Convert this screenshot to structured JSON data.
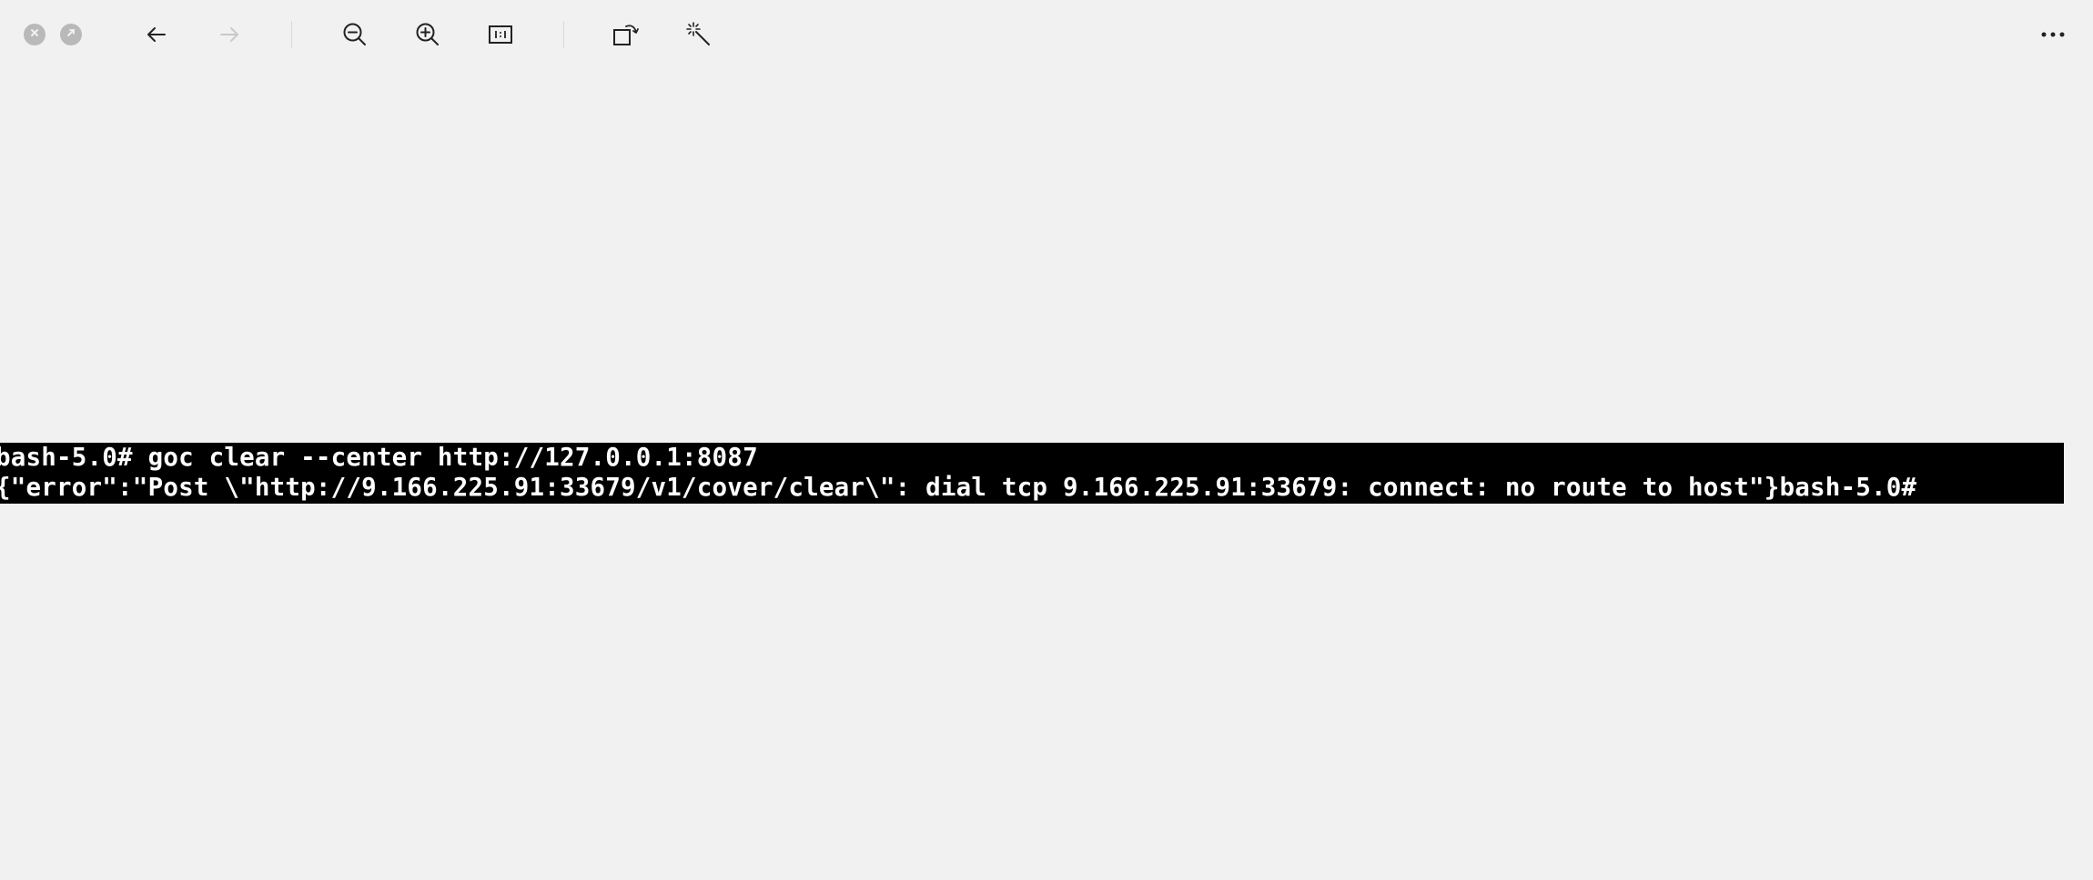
{
  "window": {
    "controls": [
      {
        "name": "close-button",
        "icon": "close-icon"
      },
      {
        "name": "restore-button",
        "icon": "restore-icon"
      }
    ]
  },
  "toolbar": {
    "items": [
      {
        "name": "back-button",
        "icon": "arrow-left-icon",
        "enabled": true
      },
      {
        "name": "forward-button",
        "icon": "arrow-right-icon",
        "enabled": false
      },
      {
        "name": "zoom-out-button",
        "icon": "zoom-out-icon"
      },
      {
        "name": "zoom-in-button",
        "icon": "zoom-in-icon"
      },
      {
        "name": "actual-size-button",
        "icon": "actual-size-icon"
      },
      {
        "name": "rotate-button",
        "icon": "rotate-icon"
      },
      {
        "name": "enhance-button",
        "icon": "magic-wand-icon"
      },
      {
        "name": "more-button",
        "icon": "more-horizontal-icon"
      }
    ]
  },
  "image": {
    "background": "#000000",
    "text_color": "#ffffff",
    "lines": [
      "bash-5.0# goc clear --center http://127.0.0.1:8087",
      "{\"error\":\"Post \\\"http://9.166.225.91:33679/v1/cover/clear\\\": dial tcp 9.166.225.91:33679: connect: no route to host\"}bash-5.0#"
    ]
  },
  "colors": {
    "page_background": "#f1f1f1",
    "icon": "#222222",
    "icon_disabled": "#c4c4c4",
    "window_control": "#b9b9b9"
  }
}
